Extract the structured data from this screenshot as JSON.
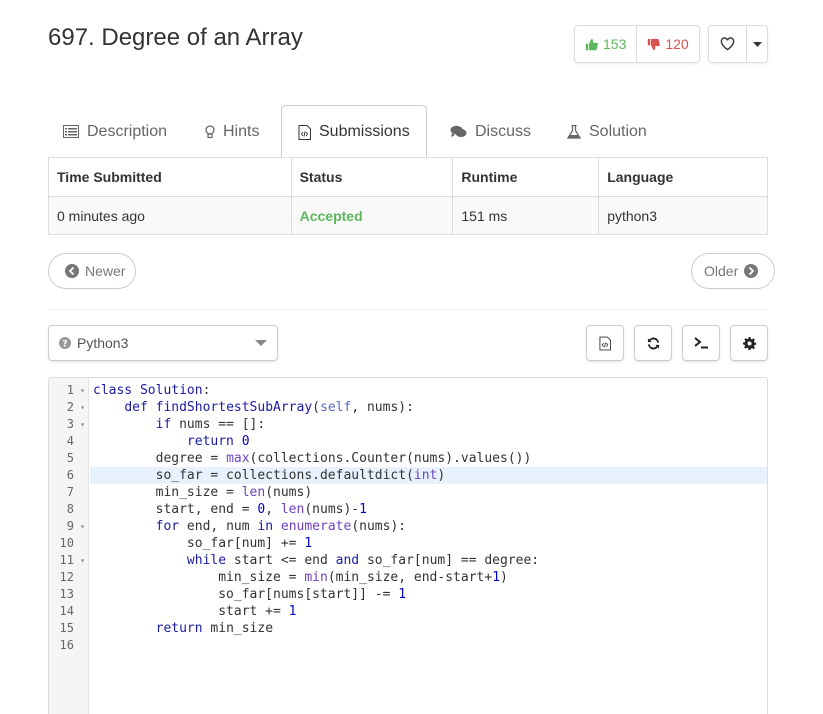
{
  "problem": {
    "title": "697. Degree of an Array"
  },
  "votes": {
    "likes": "153",
    "dislikes": "120"
  },
  "tabs": [
    {
      "label": "Description"
    },
    {
      "label": "Hints"
    },
    {
      "label": "Submissions"
    },
    {
      "label": "Discuss"
    },
    {
      "label": "Solution"
    }
  ],
  "submissions": {
    "headers": [
      "Time Submitted",
      "Status",
      "Runtime",
      "Language"
    ],
    "row": {
      "time": "0 minutes ago",
      "status": "Accepted",
      "runtime": "151 ms",
      "language": "python3"
    },
    "status_color": "#5cb85c"
  },
  "nav": {
    "newer": "Newer",
    "older": "Older"
  },
  "editor": {
    "language": "Python3",
    "lines": [
      "class Solution:",
      "    def findShortestSubArray(self, nums):",
      "        if nums == []:",
      "            return 0",
      "        degree = max(collections.Counter(nums).values())",
      "        so_far = collections.defaultdict(int)",
      "        min_size = len(nums)",
      "        start, end = 0, len(nums)-1",
      "        for end, num in enumerate(nums):",
      "            so_far[num] += 1",
      "            while start <= end and so_far[num] == degree:",
      "                min_size = min(min_size, end-start+1)",
      "                so_far[nums[start]] -= 1",
      "                start += 1",
      "        return min_size",
      ""
    ],
    "line_numbers": [
      "1",
      "2",
      "3",
      "4",
      "5",
      "6",
      "7",
      "8",
      "9",
      "10",
      "11",
      "12",
      "13",
      "14",
      "15",
      "16"
    ],
    "highlighted_line": 6
  },
  "icons": {
    "like": "thumbs-up-icon",
    "dislike": "thumbs-down-icon",
    "favorite": "heart-icon",
    "description": "list-icon",
    "hints": "lightbulb-icon",
    "submissions": "code-file-icon",
    "discuss": "comments-icon",
    "solution": "flask-icon",
    "reset": "refresh-icon",
    "console": "terminal-icon",
    "settings": "gear-icon"
  }
}
